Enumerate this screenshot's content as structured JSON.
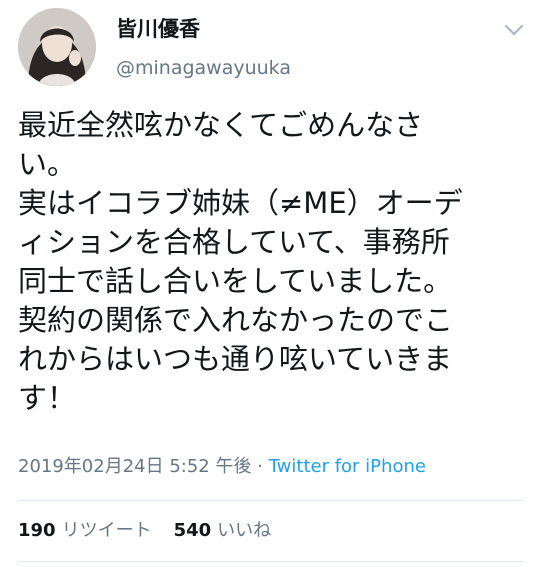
{
  "user": {
    "display_name": "皆川優香",
    "handle": "@minagawayuuka",
    "avatar_icon": "profile-photo"
  },
  "tweet": {
    "lines": [
      "最近全然呟かなくてごめんなさ",
      "い。",
      "実はイコラブ姉妹（≠ME）オーデ",
      "ィションを合格していて、事務所",
      "同士で話し合いをしていました。",
      "契約の関係で入れなかったのでこ",
      "れからはいつも通り呟いていきま",
      "す！"
    ],
    "timestamp": "2019年02月24日 5:52 午後",
    "separator": " · ",
    "client": "Twitter for iPhone"
  },
  "stats": {
    "retweets_count": "190",
    "retweets_label": "リツイート",
    "likes_count": "540",
    "likes_label": "いいね"
  },
  "menu": {
    "icon": "chevron-down-icon"
  },
  "colors": {
    "text": "#14171a",
    "secondary": "#657786",
    "link": "#1da1f2",
    "divider": "#e1e8ed"
  }
}
